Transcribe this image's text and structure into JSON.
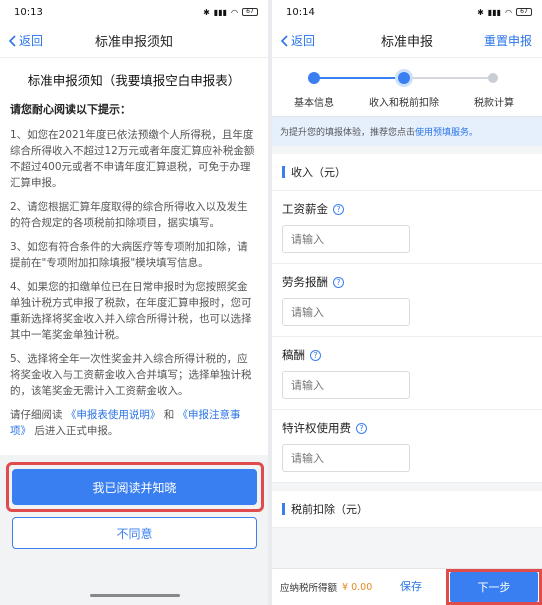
{
  "left": {
    "status": {
      "time": "10:13",
      "battery": "67"
    },
    "nav": {
      "back": "返回",
      "title": "标准申报须知"
    },
    "heading": "标准申报须知（我要填报空白申报表）",
    "intro": "请您耐心阅读以下提示：",
    "items": [
      "1、如您在2021年度已依法预缴个人所得税，且年度综合所得收入不超过12万元或者年度汇算应补税金额不超过400元或者不申请年度汇算退税，可免于办理汇算申报。",
      "2、请您根据汇算年度取得的综合所得收入以及发生的符合规定的各项税前扣除项目，据实填写。",
      "3、如您有符合条件的大病医疗等专项附加扣除，请提前在\"专项附加扣除填报\"模块填写信息。",
      "4、如果您的扣缴单位已在日常申报时为您按照奖金单独计税方式申报了税款，在年度汇算申报时，您可重新选择将奖金收入并入综合所得计税，也可以选择其中一笔奖金单独计税。",
      "5、选择将全年一次性奖金并入综合所得计税的，应将奖金收入与工资薪金收入合并填写；选择单独计税的，该笔奖金无需计入工资薪金收入。"
    ],
    "outro_pre": "请仔细阅读",
    "outro_link1": "《申报表使用说明》",
    "outro_and": "和",
    "outro_link2": "《申报注意事项》",
    "outro_post": "后进入正式申报。",
    "agree_button": "我已阅读并知晓",
    "disagree_button": "不同意"
  },
  "right": {
    "status": {
      "time": "10:14",
      "battery": "67"
    },
    "nav": {
      "back": "返回",
      "title": "标准申报",
      "reset": "重置申报"
    },
    "steps": [
      {
        "label": "基本信息",
        "state": "done"
      },
      {
        "label": "收入和税前扣除",
        "state": "current"
      },
      {
        "label": "税款计算",
        "state": "todo"
      }
    ],
    "tip_text": "为提升您的填报体验，推荐您点击",
    "tip_link": "使用预填服务。",
    "income_section": "收入（元）",
    "fields": [
      {
        "label": "工资薪金",
        "placeholder": "请输入"
      },
      {
        "label": "劳务报酬",
        "placeholder": "请输入"
      },
      {
        "label": "稿酬",
        "placeholder": "请输入"
      },
      {
        "label": "特许权使用费",
        "placeholder": "请输入"
      }
    ],
    "deduction_section": "税前扣除（元）",
    "bottom": {
      "tax_label": "应纳税所得额",
      "tax_value": "¥ 0.00",
      "save": "保存",
      "next": "下一步"
    }
  },
  "colors": {
    "accent": "#3a7ff2",
    "highlight": "#e04b4b",
    "amount": "#e58a1f"
  }
}
